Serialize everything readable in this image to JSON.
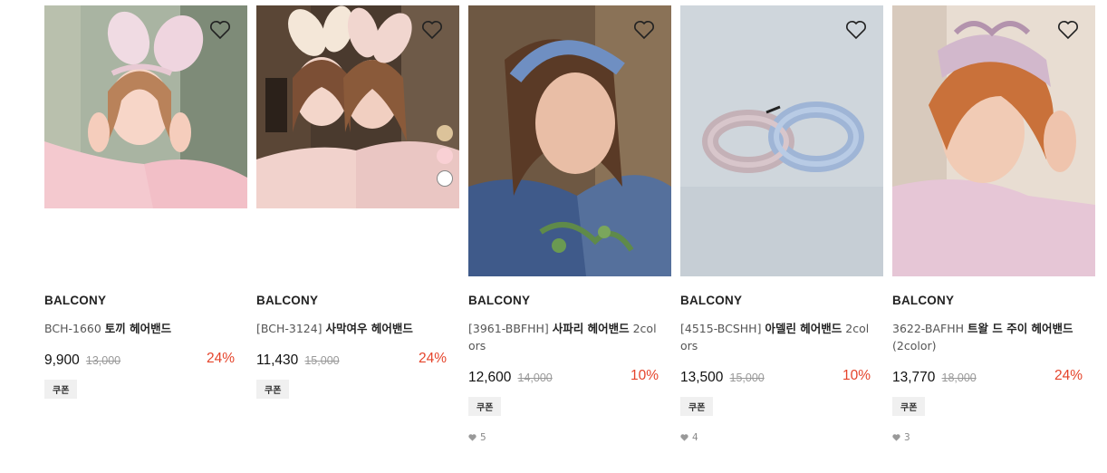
{
  "products": [
    {
      "brand": "BALCONY",
      "code": "BCH-1660",
      "name": "토끼 헤어밴드",
      "price": "9,900",
      "original_price": "13,000",
      "discount": "24%",
      "badge": "쿠폰",
      "likes": "",
      "wishlist_icon": "heart-outline-icon"
    },
    {
      "brand": "BALCONY",
      "code": "[BCH-3124]",
      "name": "사막여우 헤어밴드",
      "price": "11,430",
      "original_price": "15,000",
      "discount": "24%",
      "badge": "쿠폰",
      "likes": "",
      "wishlist_icon": "heart-outline-icon"
    },
    {
      "brand": "BALCONY",
      "code": "[3961-BBFHH]",
      "name": "사파리 헤어밴드",
      "suffix": "2colors",
      "price": "12,600",
      "original_price": "14,000",
      "discount": "10%",
      "badge": "쿠폰",
      "likes": "5",
      "wishlist_icon": "heart-outline-icon"
    },
    {
      "brand": "BALCONY",
      "code": "[4515-BCSHH]",
      "name": "아델린 헤어밴드",
      "suffix": "2colors",
      "price": "13,500",
      "original_price": "15,000",
      "discount": "10%",
      "badge": "쿠폰",
      "likes": "4",
      "wishlist_icon": "heart-outline-icon"
    },
    {
      "brand": "BALCONY",
      "code": "3622-BAFHH",
      "name": "트왈 드 주이 헤어밴드",
      "suffix": "(2color)",
      "price": "13,770",
      "original_price": "18,000",
      "discount": "24%",
      "badge": "쿠폰",
      "likes": "3",
      "wishlist_icon": "heart-outline-icon"
    }
  ],
  "color_swatches": [
    "#dcc39a",
    "#f9d0d4",
    "#ffffff"
  ],
  "colors": {
    "discount": "#e5442b",
    "badge_bg": "#f0f0f0"
  }
}
